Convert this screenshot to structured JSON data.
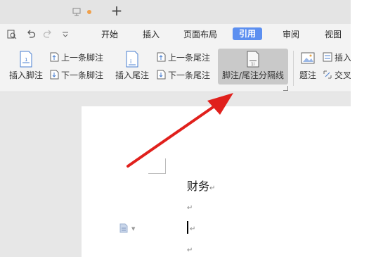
{
  "titlebar": {
    "new_tab_symbol": "+"
  },
  "tabs": {
    "home": "开始",
    "insert": "插入",
    "layout": "页面布局",
    "references": "引用",
    "review": "审阅",
    "view": "视图"
  },
  "ribbon": {
    "insert_footnote": "插入脚注",
    "prev_footnote": "上一条脚注",
    "next_footnote": "下一条脚注",
    "insert_endnote": "插入尾注",
    "prev_endnote": "上一条尾注",
    "next_endnote": "下一条尾注",
    "separator": "脚注/尾注分隔线",
    "caption": "题注",
    "insert_partial": "插入",
    "cross_partial": "交叉"
  },
  "document": {
    "heading": "财务",
    "paragraph_mark": "↵"
  },
  "colors": {
    "accent": "#5c8ff0",
    "arrow": "#e0201c",
    "highlight": "#c9c9c9"
  }
}
